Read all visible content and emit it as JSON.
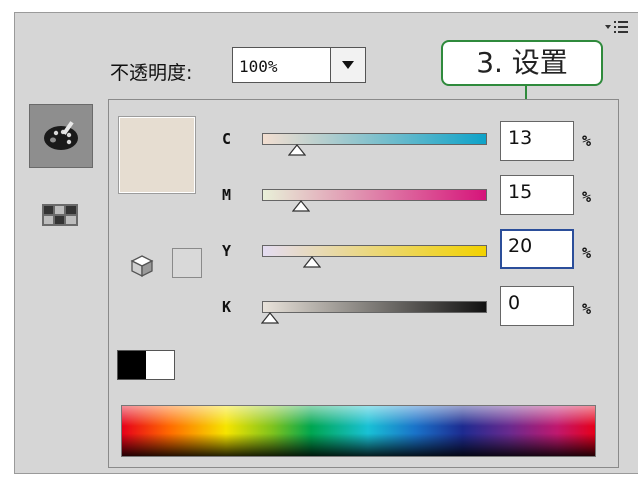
{
  "opacity": {
    "label": "不透明度:",
    "value": "100%"
  },
  "callout": {
    "text": "3. 设置"
  },
  "color_preview": {
    "color": "#e6ddd1"
  },
  "channels": [
    {
      "label": "C",
      "value": "13",
      "unit": "%",
      "level": 0.13,
      "gradient": [
        "#f3ded0",
        "#0ea3c9"
      ]
    },
    {
      "label": "M",
      "value": "15",
      "unit": "%",
      "level": 0.15,
      "gradient": [
        "#e8f0d8",
        "#d6147a"
      ]
    },
    {
      "label": "Y",
      "value": "20",
      "unit": "%",
      "level": 0.2,
      "gradient": [
        "#e4dcf2",
        "#f2d200"
      ]
    },
    {
      "label": "K",
      "value": "0",
      "unit": "%",
      "level": 0.0,
      "gradient": [
        "#e8e2da",
        "#111111"
      ]
    }
  ],
  "focused_channel": "Y",
  "icons": {
    "panel_menu": "panel-menu-icon",
    "palette": "palette-icon",
    "swatches": "swatches-grid-icon",
    "cube": "cube-icon",
    "dropdown": "dropdown-arrow-icon"
  }
}
